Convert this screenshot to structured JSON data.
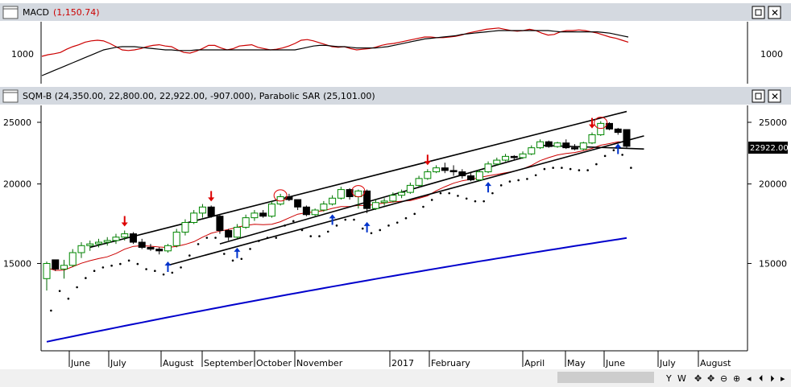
{
  "macd_panel": {
    "title": "MACD",
    "title_value": "(1,150.74)",
    "y_label": "1000",
    "chart_data": {
      "type": "line",
      "title": "MACD (1,150.74)",
      "x": [
        0,
        2,
        4,
        6,
        8,
        10,
        12,
        14,
        16,
        18,
        20,
        22,
        24,
        26,
        28,
        30,
        32,
        34,
        36,
        38,
        40,
        42,
        44,
        46,
        48,
        50,
        52,
        54,
        56,
        58,
        60,
        62,
        64,
        66,
        68,
        70,
        72,
        74,
        76,
        78,
        80,
        82,
        84,
        86,
        88,
        90,
        92,
        94,
        96,
        98,
        100,
        102,
        104,
        106,
        108,
        110,
        112,
        114,
        116,
        118,
        120,
        122,
        124,
        126,
        128,
        130,
        132,
        134,
        136,
        138,
        140,
        142,
        144,
        146,
        148,
        150,
        152,
        154,
        156,
        158,
        160,
        162,
        164,
        166,
        168,
        170,
        172,
        174,
        176,
        178,
        180,
        182,
        184,
        186,
        188,
        190
      ],
      "series": [
        {
          "color": "#cc0000",
          "values": [
            1000,
            1025,
            1040,
            1060,
            1110,
            1150,
            1180,
            1220,
            1240,
            1250,
            1240,
            1200,
            1150,
            1100,
            1090,
            1100,
            1120,
            1150,
            1170,
            1180,
            1160,
            1150,
            1100,
            1060,
            1050,
            1080,
            1120,
            1170,
            1170,
            1130,
            1100,
            1120,
            1160,
            1170,
            1180,
            1140,
            1120,
            1100,
            1110,
            1130,
            1160,
            1200,
            1250,
            1260,
            1240,
            1210,
            1180,
            1150,
            1140,
            1150,
            1120,
            1100,
            1110,
            1120,
            1140,
            1170,
            1190,
            1200,
            1220,
            1240,
            1260,
            1280,
            1300,
            1300,
            1290,
            1290,
            1300,
            1310,
            1330,
            1360,
            1380,
            1400,
            1420,
            1430,
            1440,
            1420,
            1400,
            1390,
            1400,
            1420,
            1400,
            1360,
            1330,
            1340,
            1380,
            1400,
            1400,
            1410,
            1400,
            1380,
            1360,
            1330,
            1300,
            1280,
            1250,
            1220
          ]
        },
        {
          "color": "#000000",
          "values": [
            700,
            740,
            780,
            820,
            860,
            900,
            940,
            980,
            1020,
            1060,
            1100,
            1120,
            1140,
            1150,
            1150,
            1150,
            1140,
            1130,
            1120,
            1110,
            1100,
            1100,
            1090,
            1090,
            1090,
            1100,
            1100,
            1100,
            1100,
            1100,
            1100,
            1100,
            1100,
            1100,
            1100,
            1100,
            1100,
            1100,
            1100,
            1100,
            1100,
            1100,
            1120,
            1140,
            1160,
            1170,
            1170,
            1160,
            1150,
            1150,
            1140,
            1130,
            1130,
            1130,
            1130,
            1140,
            1150,
            1170,
            1190,
            1210,
            1230,
            1250,
            1270,
            1280,
            1290,
            1300,
            1310,
            1320,
            1340,
            1350,
            1360,
            1370,
            1380,
            1390,
            1400,
            1400,
            1400,
            1400,
            1400,
            1400,
            1400,
            1400,
            1400,
            1390,
            1380,
            1380,
            1380,
            1380,
            1380,
            1380,
            1380,
            1370,
            1360,
            1340,
            1320,
            1300
          ]
        }
      ],
      "ylabels": [
        "1000"
      ]
    }
  },
  "price_panel": {
    "title": "SQM-B (24,350.00, 22,800.00, 22,922.00, -907.000), Parabolic SAR (25,101.00)",
    "last_price_label": "22922.00",
    "y_ticks": [
      "25000",
      "20000",
      "15000"
    ],
    "x_labels": [
      "June",
      "July",
      "August",
      "September",
      "October",
      "November",
      "2017",
      "February",
      "April",
      "May",
      "June",
      "July",
      "August"
    ],
    "chart_data": {
      "type": "candlestick",
      "title": "SQM-B (24,350.00, 22,800.00, 22,922.00, -907.000), Parabolic SAR (25,101.00)",
      "y_ticks": [
        25000,
        20000,
        15000
      ],
      "candles_ohlc": [
        [
          14200,
          15100,
          13600,
          15000
        ],
        [
          15200,
          15200,
          14600,
          14700
        ],
        [
          14700,
          15200,
          14200,
          14900
        ],
        [
          14900,
          15800,
          14800,
          15600
        ],
        [
          15600,
          16200,
          15300,
          16000
        ],
        [
          16000,
          16300,
          15700,
          16100
        ],
        [
          16100,
          16400,
          15900,
          16200
        ],
        [
          16200,
          16500,
          16000,
          16300
        ],
        [
          16300,
          16700,
          16100,
          16500
        ],
        [
          16500,
          16900,
          16300,
          16700
        ],
        [
          16700,
          16800,
          16100,
          16200
        ],
        [
          16200,
          16400,
          15800,
          15900
        ],
        [
          15900,
          16100,
          15700,
          15800
        ],
        [
          15800,
          15900,
          15500,
          15700
        ],
        [
          15700,
          16100,
          15600,
          16000
        ],
        [
          16000,
          17000,
          15900,
          16800
        ],
        [
          16800,
          17600,
          16600,
          17400
        ],
        [
          17400,
          18200,
          17300,
          18000
        ],
        [
          18000,
          18600,
          17700,
          18400
        ],
        [
          18400,
          18500,
          17700,
          17800
        ],
        [
          17800,
          17900,
          16700,
          16900
        ],
        [
          16900,
          17000,
          16300,
          16500
        ],
        [
          16500,
          17300,
          16400,
          17100
        ],
        [
          17100,
          17900,
          17000,
          17700
        ],
        [
          17700,
          18200,
          17500,
          18000
        ],
        [
          18000,
          18200,
          17700,
          17800
        ],
        [
          17800,
          18800,
          17700,
          18600
        ],
        [
          18600,
          19300,
          18500,
          19100
        ],
        [
          19100,
          19300,
          18800,
          18900
        ],
        [
          18900,
          18900,
          18200,
          18400
        ],
        [
          18400,
          18500,
          17800,
          17900
        ],
        [
          17900,
          18300,
          17800,
          18200
        ],
        [
          18200,
          18800,
          18100,
          18600
        ],
        [
          18600,
          19200,
          18500,
          19000
        ],
        [
          19000,
          19800,
          18900,
          19600
        ],
        [
          19600,
          19700,
          18900,
          19100
        ],
        [
          19100,
          19600,
          18300,
          19500
        ],
        [
          19500,
          19600,
          18000,
          18300
        ],
        [
          18300,
          18900,
          18200,
          18700
        ],
        [
          18700,
          19000,
          18500,
          18800
        ],
        [
          18800,
          19400,
          18700,
          19200
        ],
        [
          19200,
          19600,
          19000,
          19400
        ],
        [
          19400,
          20100,
          19300,
          19900
        ],
        [
          19900,
          20600,
          19800,
          20400
        ],
        [
          20400,
          21100,
          20300,
          20900
        ],
        [
          20900,
          21400,
          20800,
          21200
        ],
        [
          21200,
          21600,
          20800,
          21000
        ],
        [
          21000,
          21400,
          20600,
          20900
        ],
        [
          20900,
          21100,
          20400,
          20600
        ],
        [
          20600,
          20800,
          20200,
          20300
        ],
        [
          20300,
          21100,
          20200,
          20900
        ],
        [
          20900,
          21700,
          20800,
          21500
        ],
        [
          21500,
          22000,
          21400,
          21800
        ],
        [
          21800,
          22300,
          21700,
          22100
        ],
        [
          22100,
          22200,
          21800,
          22000
        ],
        [
          22000,
          22500,
          21900,
          22300
        ],
        [
          22300,
          23000,
          22200,
          22800
        ],
        [
          22800,
          23500,
          22700,
          23300
        ],
        [
          23300,
          23400,
          22800,
          22900
        ],
        [
          22900,
          23300,
          22800,
          23200
        ],
        [
          23200,
          23500,
          22700,
          22800
        ],
        [
          22800,
          23100,
          22600,
          22700
        ],
        [
          22700,
          23300,
          22600,
          23200
        ],
        [
          23200,
          24100,
          23100,
          23900
        ],
        [
          23900,
          25100,
          23800,
          24900
        ],
        [
          24900,
          25000,
          24300,
          24400
        ],
        [
          24400,
          24500,
          23900,
          24100
        ],
        [
          24350,
          24350,
          22800,
          22922
        ]
      ],
      "indicator_series": [
        {
          "name": "Parabolic SAR",
          "color": "#000000",
          "style": "dots"
        },
        {
          "color": "#cc0000"
        },
        {
          "color": "#0000cc"
        }
      ],
      "annotations": {
        "down_arrows": 5,
        "up_arrows": 8,
        "circles": 4,
        "trendlines": 4
      }
    }
  },
  "icons": {
    "close": "close-icon",
    "maximize": "maximize-icon",
    "scroll": [
      "scroll-left-icon",
      "scroll-right-icon",
      "scroll-end-icon",
      "scroll-start-icon"
    ]
  },
  "bottom_toolbar": [
    "Y",
    "W",
    "✥",
    "✥",
    "⊖",
    "⊕"
  ]
}
